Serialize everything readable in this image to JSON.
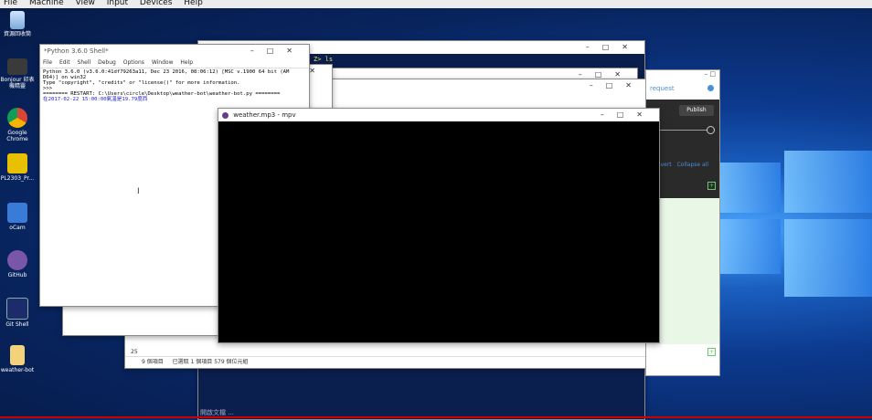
{
  "menubar": [
    "File",
    "Machine",
    "View",
    "Input",
    "Devices",
    "Help"
  ],
  "desktop_icons": [
    {
      "label": "資源回收筒",
      "name": "recycle-bin-icon"
    },
    {
      "label": "Bonjour 印表機精靈",
      "name": "printer-icon"
    },
    {
      "label": "Google Chrome",
      "name": "chrome-icon"
    },
    {
      "label": "PL2303_Pr...",
      "name": "pl2303-icon"
    },
    {
      "label": "oCam",
      "name": "ocam-icon"
    },
    {
      "label": "GitHub",
      "name": "github-icon"
    },
    {
      "label": "Git Shell",
      "name": "git-shell-icon"
    },
    {
      "label": "weather-bot",
      "name": "weather-bot-icon"
    }
  ],
  "python_shell": {
    "title": "*Python 3.6.0 Shell*",
    "menu": [
      "File",
      "Edit",
      "Shell",
      "Debug",
      "Options",
      "Window",
      "Help"
    ],
    "line1": "Python 3.6.0 (v3.6.0:41df79263a11, Dec 23 2016, 08:06:12) [MSC v.1900 64 bit (AM",
    "line2": "D64)] on win32",
    "line3": "Type \"copyright\", \"credits\" or \"license()\" for more information.",
    "line4": ">>> ",
    "line5": "======== RESTART: C:\\Users\\circle\\Desktop\\weather-bot\\weather-bot.py ========",
    "line6": "在2017-02-22 15:00:00氣溫是19.79度西"
  },
  "terminal": {
    "prompt": "Z> ls"
  },
  "mpv": {
    "title": "weather.mp3 - mpv"
  },
  "explorer": {
    "status_items": "9 個項目",
    "status_selected": "已選取 1 個項目  579 個位元組",
    "footer_num": "25"
  },
  "github": {
    "request": "request",
    "publish": "Publish",
    "revert": "Revert",
    "collapse": "Collapse all"
  },
  "bottom_text": "開啟文檔 ..."
}
